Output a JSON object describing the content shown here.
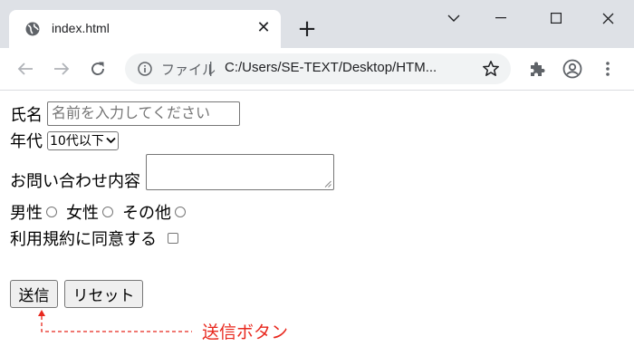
{
  "browser": {
    "tab_title": "index.html",
    "tab_close": "✕",
    "new_tab": "+",
    "address_label": "ファイル",
    "address_separator": "|",
    "address_url": "C:/Users/SE-TEXT/Desktop/HTM..."
  },
  "form": {
    "name_label": "氏名",
    "name_placeholder": "名前を入力してください",
    "age_label": "年代",
    "age_selected": "10代以下",
    "inquiry_label": "お問い合わせ内容",
    "gender_options": [
      "男性",
      "女性",
      "その他"
    ],
    "terms_label": "利用規約に同意する",
    "submit_label": "送信",
    "reset_label": "リセット"
  },
  "annotation": {
    "text": "送信ボタン",
    "color": "#e8281e"
  },
  "colors": {
    "titlebar": "#dee1e6",
    "omnibox": "#f1f3f4",
    "icon": "#5f6368"
  }
}
